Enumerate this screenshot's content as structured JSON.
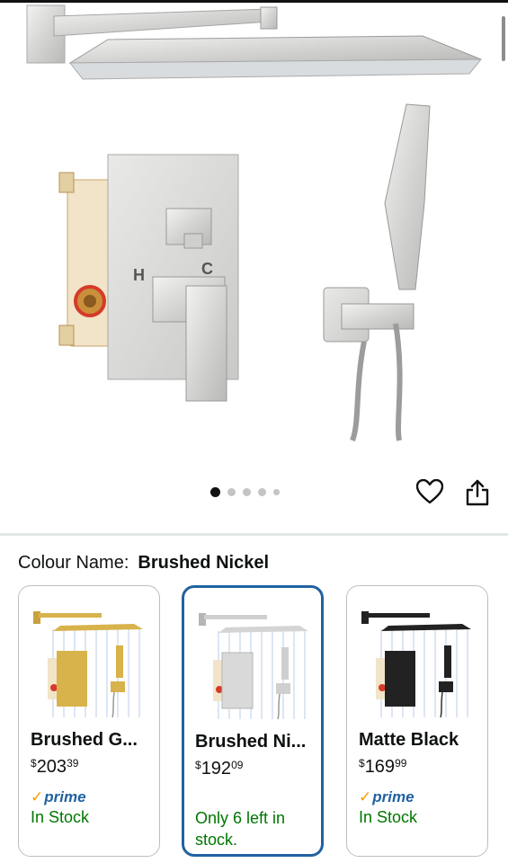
{
  "product": {
    "image_alt": "Brushed nickel rain shower system",
    "gallery_count": 5,
    "gallery_active_index": 0
  },
  "colour": {
    "label": "Colour Name:",
    "selected": "Brushed Nickel"
  },
  "variants": [
    {
      "name": "Brushed G...",
      "price_symbol": "$",
      "price_whole": "203",
      "price_cents": "39",
      "prime": "prime",
      "stock": "In Stock",
      "finish_color": "#d8b24a"
    },
    {
      "name": "Brushed Ni...",
      "price_symbol": "$",
      "price_whole": "192",
      "price_cents": "09",
      "prime": "",
      "stock": "Only 6 left in stock.",
      "finish_color": "#bdbdbd",
      "selected": true
    },
    {
      "name": "Matte Black",
      "price_symbol": "$",
      "price_whole": "169",
      "price_cents": "99",
      "prime": "prime",
      "stock": "In Stock",
      "finish_color": "#222222"
    }
  ],
  "colors": {
    "selected_border": "#2162a1",
    "in_stock": "#007600",
    "prime_blue": "#2162a1",
    "prime_check": "#ff9900"
  },
  "icons": [
    "heart-icon",
    "share-icon",
    "check-icon"
  ]
}
